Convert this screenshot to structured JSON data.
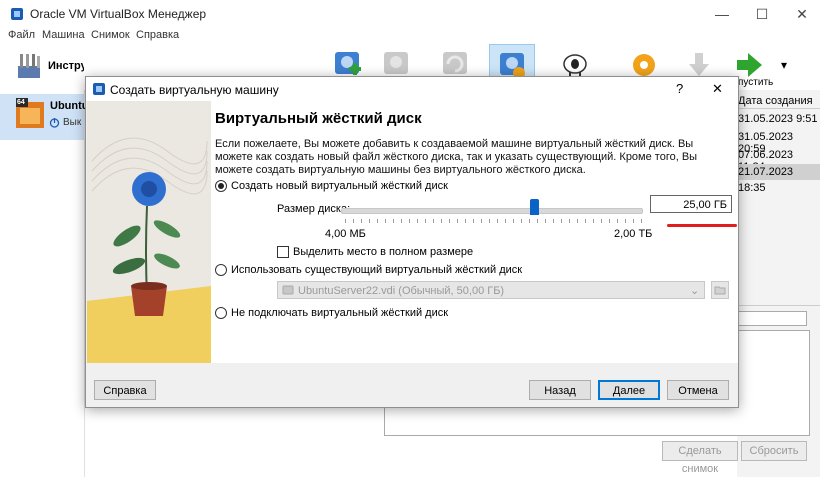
{
  "main_window": {
    "title": "Oracle VM VirtualBox Менеджер",
    "controls": {
      "minimize": "—",
      "maximize": "☐",
      "close": "✕"
    }
  },
  "menu": [
    "Файл",
    "Машина",
    "Снимок",
    "Справка"
  ],
  "left_pane": {
    "tools_label": "Инструменты",
    "vm": {
      "name": "Ubuntu",
      "state": "Вык",
      "badge": "64"
    }
  },
  "toolbar": {
    "start_label": "пустить",
    "dropdown_glyph": "▾"
  },
  "snapshots": {
    "header": "Дата создания",
    "dates": [
      "31.05.2023 9:51",
      "31.05.2023 20:59",
      "07.06.2023 11:24",
      "21.07.2023 18:35"
    ],
    "take_snapshot": "Сделать снимок",
    "reset": "Сбросить"
  },
  "dialog": {
    "title": "Создать виртуальную машину",
    "help_glyph": "?",
    "close_glyph": "✕",
    "heading": "Виртуальный жёсткий диск",
    "description": "Если пожелаете, Вы можете добавить к создаваемой машине виртуальный жёсткий диск. Вы можете как создать новый файл жёсткого диска, так и указать существующий. Кроме того, Вы можете создать виртуальную машины без виртуального жёсткого диска.",
    "option_new": "Создать новый виртуальный жёсткий диск",
    "disk_size_label": "Размер диска:",
    "disk_size_value": "25,00 ГБ",
    "slider_level": 0.64,
    "slider_min": "4,00 МБ",
    "slider_max": "2,00 ТБ",
    "preallocate_label": "Выделить место в полном размере",
    "preallocate_checked": false,
    "option_existing": "Использовать существующий виртуальный жёсткий диск",
    "existing_disk": "UbuntuServer22.vdi (Обычный, 50,00 ГБ)",
    "option_none": "Не подключать виртуальный жёсткий диск",
    "selected_option": "new",
    "buttons": {
      "help": "Справка",
      "back": "Назад",
      "next": "Далее",
      "cancel": "Отмена"
    }
  },
  "colors": {
    "accent": "#0078d7",
    "underline": "#e11d1d",
    "selection": "#cfe2f6"
  }
}
